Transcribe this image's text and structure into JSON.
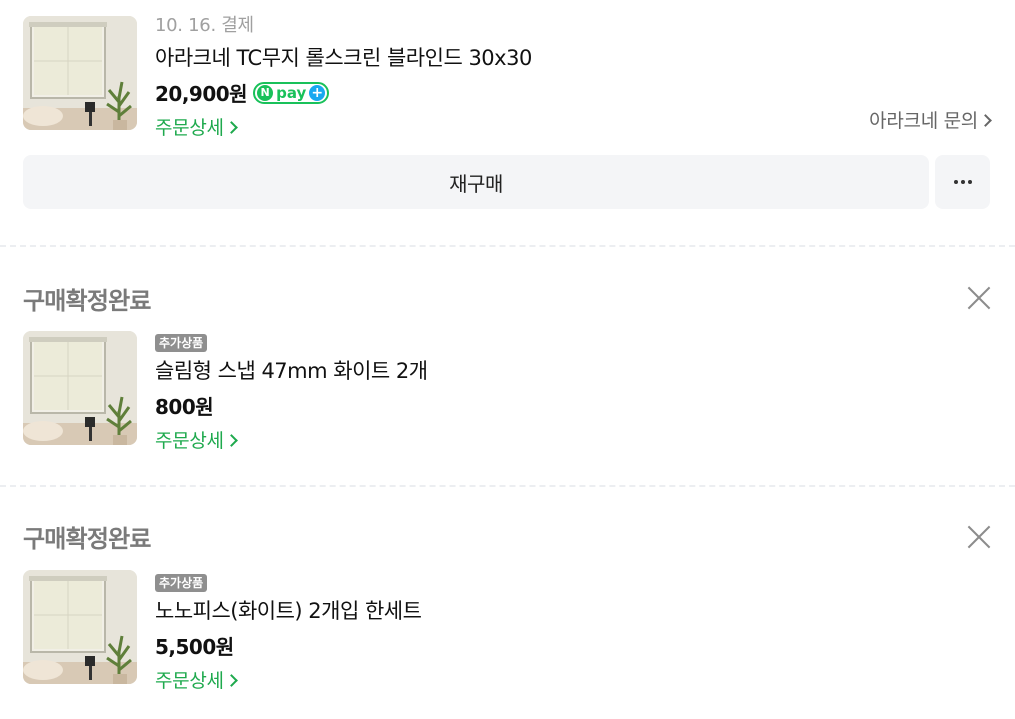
{
  "orders": [
    {
      "date": "10. 16. 결제",
      "product_name": "아라크네 TC무지 롤스크린 블라인드 30x30",
      "price": "20,900원",
      "payment_badge": {
        "n": "N",
        "text": "pay",
        "plus": "+"
      },
      "detail_link": "주문상세",
      "inquiry_link": "아라크네 문의",
      "rebuy_label": "재구매",
      "more_icon": "ellipsis-icon"
    },
    {
      "status": "구매확정완료",
      "badge": "추가상품",
      "product_name": "슬림형 스냅 47mm 화이트 2개",
      "price": "800원",
      "detail_link": "주문상세",
      "close_icon": "close-icon"
    },
    {
      "status": "구매확정완료",
      "badge": "추가상품",
      "product_name": "노노피스(화이트) 2개입 한세트",
      "price": "5,500원",
      "detail_link": "주문상세",
      "close_icon": "close-icon"
    }
  ],
  "colors": {
    "accent_green": "#1ea94d",
    "npay_green": "#19c15a",
    "npay_blue": "#19a8f0",
    "button_bg": "#f4f5f7",
    "status_gray": "#7a7a7a"
  }
}
